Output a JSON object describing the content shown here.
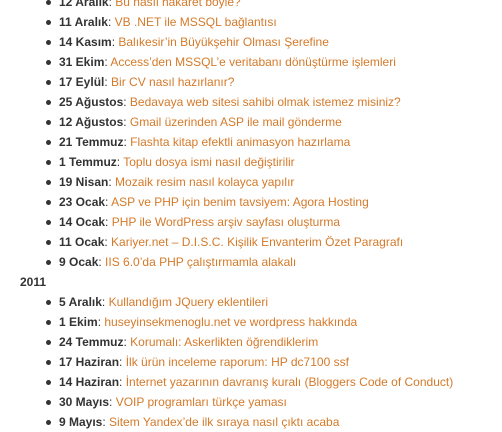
{
  "colors": {
    "link": "#d47a2a",
    "text": "#333333",
    "background": "#ffffff"
  },
  "groups": [
    {
      "year": "",
      "posts": [
        {
          "date": "12 Aralık",
          "title": "Bu nasıl hakaret böyle?"
        },
        {
          "date": "11 Aralık",
          "title": "VB .NET ile MSSQL bağlantısı"
        },
        {
          "date": "14 Kasım",
          "title": "Balıkesir’in Büyükşehir Olması Şerefine"
        },
        {
          "date": "31 Ekim",
          "title": "Access’den MSSQL’e veritabanı dönüştürme işlemleri"
        },
        {
          "date": "17 Eylül",
          "title": "Bir CV nasıl hazırlanır?"
        },
        {
          "date": "25 Ağustos",
          "title": "Bedavaya web sitesi sahibi olmak istemez misiniz?"
        },
        {
          "date": "12 Ağustos",
          "title": "Gmail üzerinden ASP ile mail gönderme"
        },
        {
          "date": "21 Temmuz",
          "title": "Flashta kitap efektli animasyon hazırlama"
        },
        {
          "date": "1 Temmuz",
          "title": "Toplu dosya ismi nasıl değiştirilir"
        },
        {
          "date": "19 Nisan",
          "title": "Mozaik resim nasıl kolayca yapılır"
        },
        {
          "date": "23 Ocak",
          "title": "ASP ve PHP için benim tavsiyem: Agora Hosting"
        },
        {
          "date": "14 Ocak",
          "title": "PHP ile WordPress arşiv sayfası oluşturma"
        },
        {
          "date": "11 Ocak",
          "title": "Kariyer.net – D.I.S.C. Kişilik Envanterim Özet Paragrafı"
        },
        {
          "date": "9 Ocak",
          "title": "IIS 6.0’da PHP çalıştırmamla alakalı"
        }
      ]
    },
    {
      "year": "2011",
      "posts": [
        {
          "date": "5 Aralık",
          "title": "Kullandığım JQuery eklentileri"
        },
        {
          "date": "1 Ekim",
          "title": "huseyinsekmenoglu.net ve wordpress hakkında"
        },
        {
          "date": "24 Temmuz",
          "title": "Korumalı: Askerlikten öğrendiklerim"
        },
        {
          "date": "17 Haziran",
          "title": "İlk ürün inceleme raporum: HP dc7100 ssf"
        },
        {
          "date": "14 Haziran",
          "title": "İnternet yazarının davranış kuralı (Bloggers Code of Conduct)"
        },
        {
          "date": "30 Mayıs",
          "title": "VOIP programları türkçe yaması"
        },
        {
          "date": "9 Mayıs",
          "title": "Sitem Yandex’de ilk sıraya nasıl çıktı acaba"
        }
      ]
    }
  ]
}
